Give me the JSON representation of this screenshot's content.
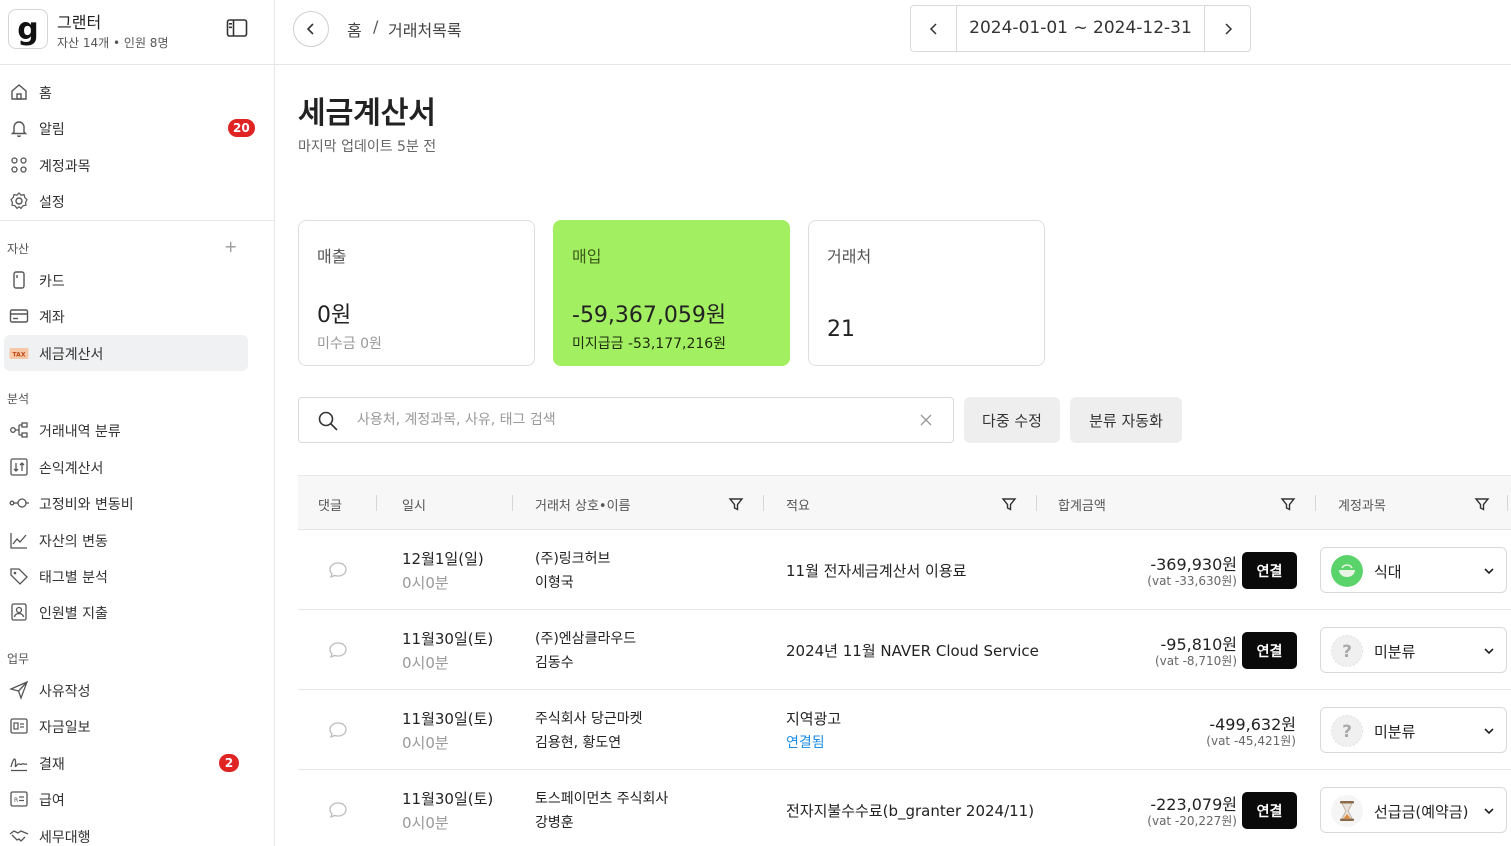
{
  "org": {
    "logo_letter": "g",
    "name": "그랜터",
    "sub": "자산 14개 • 인원 8명"
  },
  "nav_top": [
    {
      "label": "홈",
      "icon": "home-icon"
    },
    {
      "label": "알림",
      "icon": "bell-icon",
      "badge": "20"
    },
    {
      "label": "계정과목",
      "icon": "grid-icon"
    },
    {
      "label": "설정",
      "icon": "gear-icon"
    }
  ],
  "sections": {
    "assets": "자산",
    "analysis": "분석",
    "work": "업무"
  },
  "nav_assets": [
    {
      "label": "카드",
      "icon": "card-icon"
    },
    {
      "label": "계좌",
      "icon": "bank-account-icon"
    },
    {
      "label": "세금계산서",
      "icon": "tax-icon",
      "tag": "TAX",
      "active": true
    }
  ],
  "nav_analysis": [
    {
      "label": "거래내역 분류",
      "icon": "classify-icon"
    },
    {
      "label": "손익계산서",
      "icon": "income-statement-icon"
    },
    {
      "label": "고정비와 변동비",
      "icon": "fixed-variable-icon"
    },
    {
      "label": "자산의 변동",
      "icon": "trend-icon"
    },
    {
      "label": "태그별 분석",
      "icon": "tag-icon"
    },
    {
      "label": "인원별 지출",
      "icon": "person-icon"
    }
  ],
  "nav_work": [
    {
      "label": "사유작성",
      "icon": "send-icon"
    },
    {
      "label": "자금일보",
      "icon": "report-icon"
    },
    {
      "label": "결재",
      "icon": "signature-icon",
      "badge": "2"
    },
    {
      "label": "급여",
      "icon": "payroll-icon"
    },
    {
      "label": "세무대행",
      "icon": "handshake-icon"
    }
  ],
  "breadcrumb": {
    "home": "홈",
    "sep": "/",
    "current": "거래처목록"
  },
  "date_range": "2024-01-01 ~ 2024-12-31",
  "page": {
    "title": "세금계산서",
    "updated": "마지막 업데이트 5분 전"
  },
  "cards": [
    {
      "label": "매출",
      "value": "0원",
      "sub": "미수금 0원"
    },
    {
      "label": "매입",
      "value": "-59,367,059원",
      "sub": "미지급금 -53,177,216원"
    },
    {
      "label": "거래처",
      "value": "21"
    }
  ],
  "search": {
    "placeholder": "사용처, 계정과목, 사유, 태그 검색",
    "value": ""
  },
  "buttons": {
    "bulk_edit": "다중 수정",
    "auto_classify": "분류 자동화",
    "link": "연결"
  },
  "table": {
    "headers": [
      "댓글",
      "일시",
      "거래처 상호•이름",
      "적요",
      "합계금액",
      "계정과목"
    ],
    "rows": [
      {
        "date": "12월1일(일)",
        "time": "0시0분",
        "vendor": "(주)링크허브",
        "person": "이형국",
        "memo": "11월 전자세금계산서 이용료",
        "amount": "-369,930원",
        "vat": "(vat -33,630원)",
        "linked": false,
        "account": "식대",
        "account_icon": "food-bowl-icon",
        "account_color": "#5bd36b"
      },
      {
        "date": "11월30일(토)",
        "time": "0시0분",
        "vendor": "(주)엔삼클라우드",
        "person": "김동수",
        "memo": "2024년 11월 NAVER Cloud Service",
        "amount": "-95,810원",
        "vat": "(vat -8,710원)",
        "linked": false,
        "account": "미분류",
        "account_icon": "question-icon",
        "account_color": "#f0f0f0"
      },
      {
        "date": "11월30일(토)",
        "time": "0시0분",
        "vendor": "주식회사 당근마켓",
        "person": "김용현, 황도연",
        "memo": "지역광고",
        "memo_link": "연결됨",
        "amount": "-499,632원",
        "vat": "(vat -45,421원)",
        "linked": true,
        "account": "미분류",
        "account_icon": "question-icon",
        "account_color": "#f0f0f0"
      },
      {
        "date": "11월30일(토)",
        "time": "0시0분",
        "vendor": "토스페이먼츠 주식회사",
        "person": "강병훈",
        "memo": "전자지불수수료(b_granter 2024/11)",
        "amount": "-223,079원",
        "vat": "(vat -20,227원)",
        "linked": false,
        "account": "선급금(예약금)",
        "account_icon": "hourglass-icon",
        "account_color": "#f5f5f5"
      }
    ]
  },
  "colors": {
    "purchase_card": "#a3ef62",
    "badge": "#e02424",
    "link_text": "#1b8ee8"
  }
}
